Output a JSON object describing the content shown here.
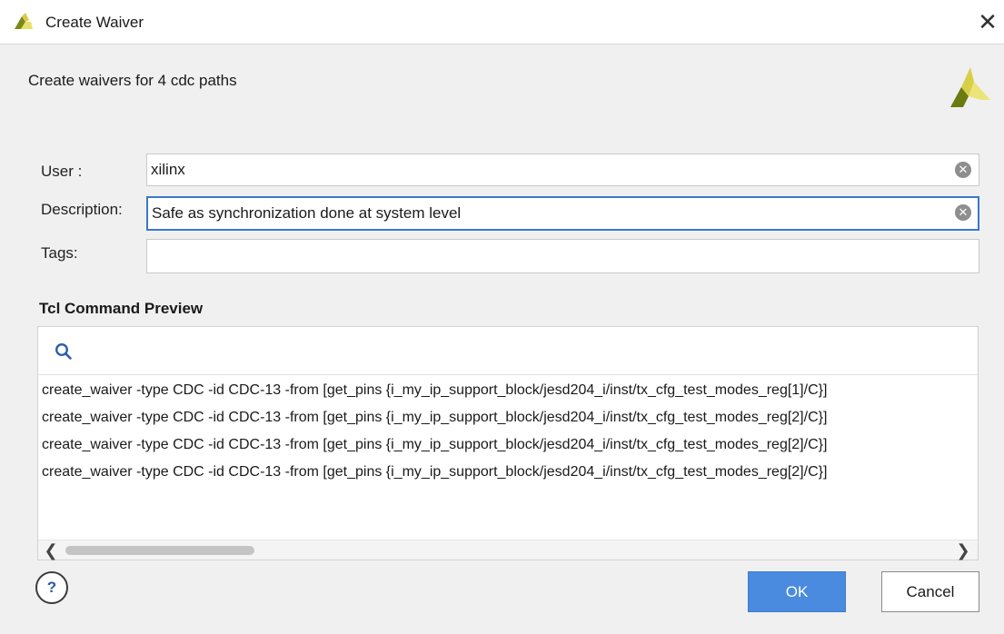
{
  "window": {
    "title": "Create Waiver",
    "close_glyph": "✕",
    "logo_icon": "xilinx-logo-icon"
  },
  "banner": {
    "text": "Create waivers for 4 cdc paths",
    "logo_icon": "xilinx-logo-icon"
  },
  "form": {
    "user": {
      "label": "User :",
      "value": "xilinx"
    },
    "description": {
      "label": "Description:",
      "value": "Safe as synchronization done at system level"
    },
    "tags": {
      "label": "Tags:",
      "value": ""
    },
    "clear_glyph": "✕"
  },
  "preview": {
    "title": "Tcl Command Preview",
    "search_icon": "search-icon",
    "lines": [
      "create_waiver -type CDC -id CDC-13 -from [get_pins {i_my_ip_support_block/jesd204_i/inst/tx_cfg_test_modes_reg[1]/C}]",
      "create_waiver -type CDC -id CDC-13 -from [get_pins {i_my_ip_support_block/jesd204_i/inst/tx_cfg_test_modes_reg[2]/C}]",
      "create_waiver -type CDC -id CDC-13 -from [get_pins {i_my_ip_support_block/jesd204_i/inst/tx_cfg_test_modes_reg[2]/C}]",
      "create_waiver -type CDC -id CDC-13 -from [get_pins {i_my_ip_support_block/jesd204_i/inst/tx_cfg_test_modes_reg[2]/C}]"
    ],
    "scroll_left_glyph": "❮",
    "scroll_right_glyph": "❯"
  },
  "footer": {
    "help_label": "?",
    "ok_label": "OK",
    "cancel_label": "Cancel"
  },
  "colors": {
    "accent": "#4a8be0",
    "focus_border": "#3a78c9",
    "logo_green": "#7a8a1a",
    "logo_yellow": "#e8e06a"
  }
}
